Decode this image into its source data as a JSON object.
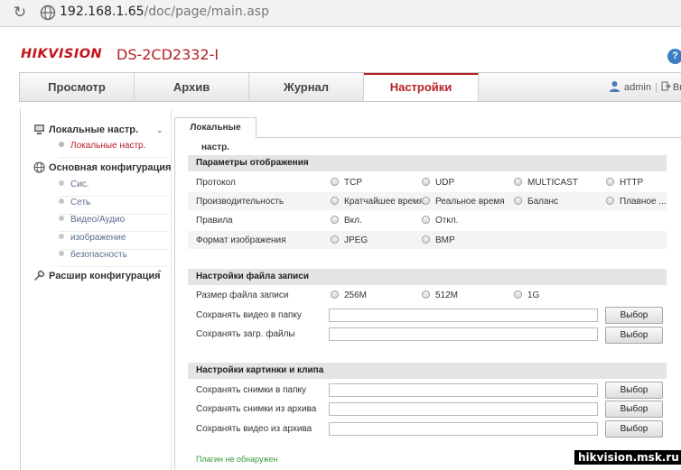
{
  "browser": {
    "url_host": "192.168.1.65",
    "url_path": "/doc/page/main.asp",
    "reload_icon": "reload-icon",
    "site_icon": "globe-icon"
  },
  "header": {
    "brand": "HIKVISION",
    "model": "DS-2CD2332-I",
    "help_icon": "?"
  },
  "nav": {
    "tabs": [
      {
        "label": "Просмотр"
      },
      {
        "label": "Архив"
      },
      {
        "label": "Журнал"
      },
      {
        "label": "Настройки"
      }
    ],
    "active_tab": "Настройки",
    "user": "admin",
    "separator": "|",
    "logout": "Выход"
  },
  "sidebar": {
    "groups": [
      {
        "label": "Локальные настр.",
        "icon": "monitor-icon",
        "items": [
          {
            "label": "Локальные настр."
          }
        ]
      },
      {
        "label": "Основная конфигурация",
        "icon": "globe-icon",
        "items": [
          {
            "label": "Сис."
          },
          {
            "label": "Сеть"
          },
          {
            "label": "Видео/Аудио"
          },
          {
            "label": "изображение"
          },
          {
            "label": "безопасность"
          }
        ]
      },
      {
        "label": "Расшир конфигурация",
        "icon": "wrench-icon",
        "items": []
      }
    ],
    "active_item": "Локальные настр."
  },
  "content": {
    "subtab": "Локальные настр.",
    "display": {
      "title": "Параметры отображения",
      "protocol": {
        "label": "Протокол",
        "options": [
          "TCP",
          "UDP",
          "MULTICAST",
          "HTTP"
        ]
      },
      "performance": {
        "label": "Производительность",
        "options": [
          "Кратчайшее время",
          "Реальное время",
          "Баланс",
          "Плавное ..."
        ]
      },
      "rules": {
        "label": "Правила",
        "options": [
          "Вкл.",
          "Откл."
        ]
      },
      "image_format": {
        "label": "Формат изображения",
        "options": [
          "JPEG",
          "BMP"
        ]
      }
    },
    "record": {
      "title": "Настройки файла записи",
      "file_size": {
        "label": "Размер файла записи",
        "options": [
          "256M",
          "512M",
          "1G"
        ]
      },
      "save_video": {
        "label": "Сохранять видео в папку",
        "value": "",
        "button": "Выбор"
      },
      "save_downloads": {
        "label": "Сохранять загр. файлы",
        "value": "",
        "button": "Выбор"
      }
    },
    "picture": {
      "title": "Настройки картинки и клипа",
      "save_snapshots": {
        "label": "Сохранять снимки в папку",
        "value": "",
        "button": "Выбор"
      },
      "save_snapshots_archive": {
        "label": "Сохранять снимки из архива",
        "value": "",
        "button": "Выбор"
      },
      "save_video_archive": {
        "label": "Сохранять видео из архива",
        "value": "",
        "button": "Выбор"
      }
    },
    "plugin_status": "Плагин не обнаружен"
  },
  "watermark": "hikvision.msk.ru",
  "colors": {
    "brand_red": "#c2141b",
    "active_tab": "#b8202a",
    "section_bg": "#e4e4e4",
    "plugin_green": "#3a9a3a"
  }
}
